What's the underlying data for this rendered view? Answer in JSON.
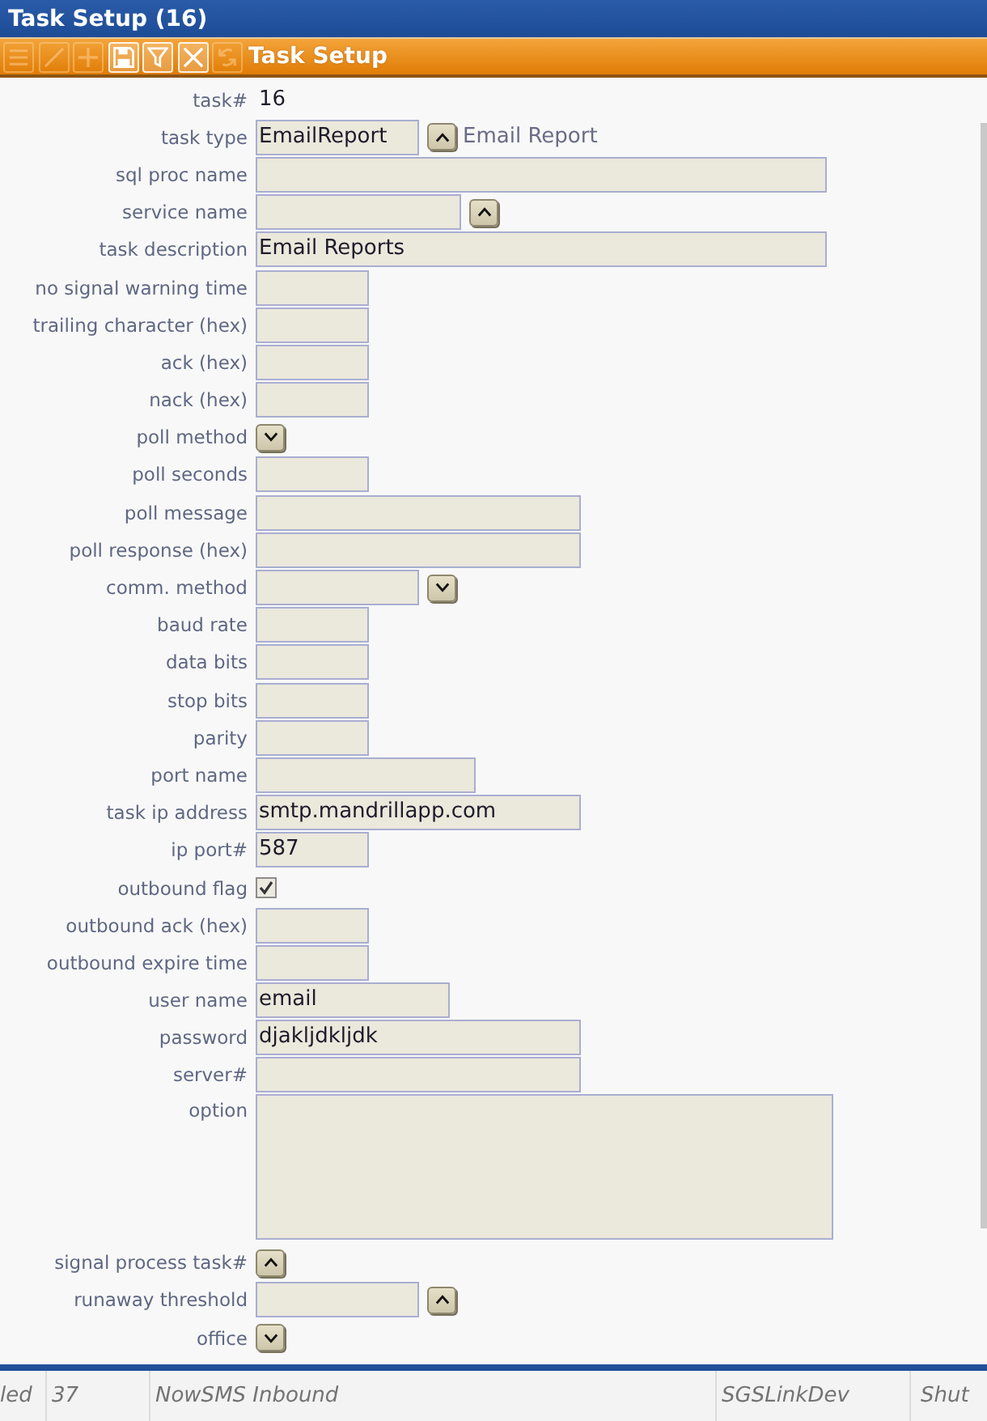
{
  "window": {
    "title": "Task Setup (16)"
  },
  "toolbar": {
    "title": "Task Setup",
    "tools": [
      {
        "kind": "list",
        "disabled": true
      },
      {
        "kind": "edit",
        "disabled": true
      },
      {
        "kind": "add",
        "disabled": true
      },
      {
        "kind": "save",
        "disabled": false
      },
      {
        "kind": "filter",
        "disabled": false
      },
      {
        "kind": "delete",
        "disabled": false
      },
      {
        "kind": "refresh",
        "disabled": true
      }
    ]
  },
  "fields": [
    {
      "label": "task#",
      "kind": "text",
      "value": "16"
    },
    {
      "label": "task type",
      "kind": "input-lookup",
      "value": "EmailReport",
      "description": "Email Report"
    },
    {
      "label": "sql proc name",
      "kind": "input"
    },
    {
      "label": "service name",
      "kind": "input-lookup"
    },
    {
      "label": "task description",
      "kind": "input",
      "value": "Email Reports"
    },
    {
      "label": "no signal warning time",
      "kind": "input"
    },
    {
      "label": "trailing character (hex)",
      "kind": "input"
    },
    {
      "label": "ack (hex)",
      "kind": "input"
    },
    {
      "label": "nack (hex)",
      "kind": "input"
    },
    {
      "label": "poll method",
      "kind": "dropdown"
    },
    {
      "label": "poll seconds",
      "kind": "input"
    },
    {
      "label": "poll message",
      "kind": "input"
    },
    {
      "label": "poll response (hex)",
      "kind": "input"
    },
    {
      "label": "comm. method",
      "kind": "input-dropdown"
    },
    {
      "label": "baud rate",
      "kind": "input"
    },
    {
      "label": "data bits",
      "kind": "input"
    },
    {
      "label": "stop bits",
      "kind": "input"
    },
    {
      "label": "parity",
      "kind": "input"
    },
    {
      "label": "port name",
      "kind": "input"
    },
    {
      "label": "task ip address",
      "kind": "input",
      "value": "smtp.mandrillapp.com"
    },
    {
      "label": "ip port#",
      "kind": "input",
      "value": "587"
    },
    {
      "label": "outbound flag",
      "kind": "checkbox",
      "checked": true
    },
    {
      "label": "outbound ack (hex)",
      "kind": "input"
    },
    {
      "label": "outbound expire time",
      "kind": "input"
    },
    {
      "label": "user name",
      "kind": "input",
      "value": "email"
    },
    {
      "label": "password",
      "kind": "input",
      "value": "djakljdkljdk"
    },
    {
      "label": "server#",
      "kind": "input"
    },
    {
      "label": "option",
      "kind": "textarea"
    },
    {
      "label": "signal process task#",
      "kind": "lookup"
    },
    {
      "label": "runaway threshold",
      "kind": "input-lookup"
    },
    {
      "label": "office",
      "kind": "dropdown"
    }
  ],
  "status_bar": {
    "cells": [
      "led",
      "37",
      "NowSMS Inbound",
      "SGSLinkDev",
      "Shut"
    ]
  }
}
